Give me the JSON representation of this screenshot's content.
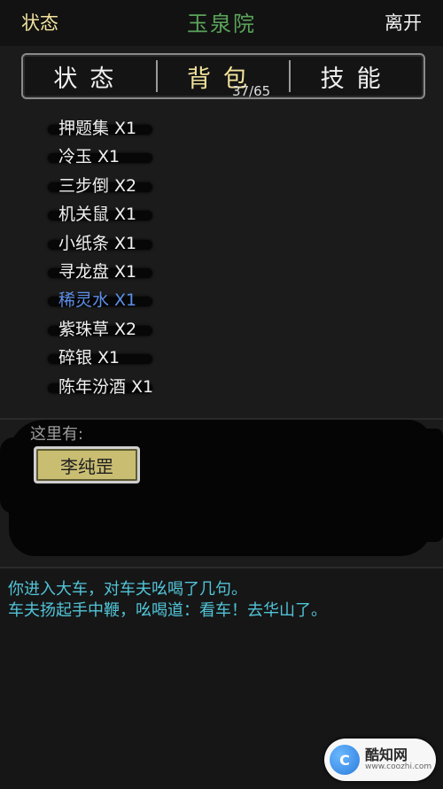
{
  "header": {
    "left_label": "状态",
    "title": "玉泉院",
    "right_label": "离开"
  },
  "tabs": [
    {
      "label": "状态",
      "active": false
    },
    {
      "label": "背包",
      "active": true
    },
    {
      "label": "技能",
      "active": false
    }
  ],
  "bag": {
    "count_text": "37/65",
    "items": [
      {
        "label": "押题集 X1",
        "highlight": false
      },
      {
        "label": "冷玉 X1",
        "highlight": false
      },
      {
        "label": "三步倒 X2",
        "highlight": false
      },
      {
        "label": "机关鼠 X1",
        "highlight": false
      },
      {
        "label": "小纸条 X1",
        "highlight": false
      },
      {
        "label": "寻龙盘 X1",
        "highlight": false
      },
      {
        "label": "稀灵水 X1",
        "highlight": true
      },
      {
        "label": "紫珠草 X2",
        "highlight": false
      },
      {
        "label": "碎银 X1",
        "highlight": false
      },
      {
        "label": "陈年汾酒 X1",
        "highlight": false
      }
    ]
  },
  "here": {
    "label": "这里有:",
    "npc_button": "李纯罡"
  },
  "log": {
    "lines": [
      "你进入大车，对车夫吆喝了几句。",
      "车夫扬起手中鞭，吆喝道：看车！去华山了。"
    ]
  },
  "watermark": {
    "mark": "C",
    "name": "酷知网",
    "url": "www.coozhi.com"
  },
  "colors": {
    "accent_gold": "#f2e39d",
    "title_green": "#5aa35a",
    "highlight_blue": "#5d8fe8",
    "log_cyan": "#51c4d8",
    "npc_button": "#c9bd72"
  }
}
